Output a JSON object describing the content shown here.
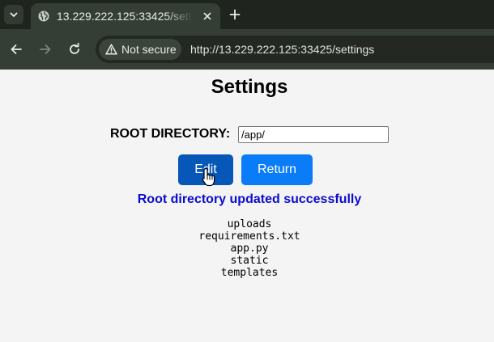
{
  "browser": {
    "tab_title": "13.229.222.125:33425/settings",
    "security_label": "Not secure",
    "url": "http://13.229.222.125:33425/settings",
    "icons": {
      "tab_menu": "chevron-down-icon",
      "favicon": "globe-icon",
      "tab_close": "close-icon",
      "new_tab": "plus-icon",
      "back": "arrow-left-icon",
      "forward": "arrow-right-icon",
      "reload": "reload-icon",
      "security": "warning-triangle-icon"
    }
  },
  "page": {
    "title": "Settings",
    "root_dir_label": "ROOT DIRECTORY:",
    "root_dir_value": "/app/",
    "edit_label": "Edit",
    "return_label": "Return",
    "status_message": "Root directory updated successfully",
    "files": [
      "uploads",
      "requirements.txt",
      "app.py",
      "static",
      "templates"
    ]
  },
  "colors": {
    "edit_button": "#0657b7",
    "return_button": "#0a7cf8",
    "status_text": "#0b0bd0",
    "page_background": "#f4f4f4"
  }
}
